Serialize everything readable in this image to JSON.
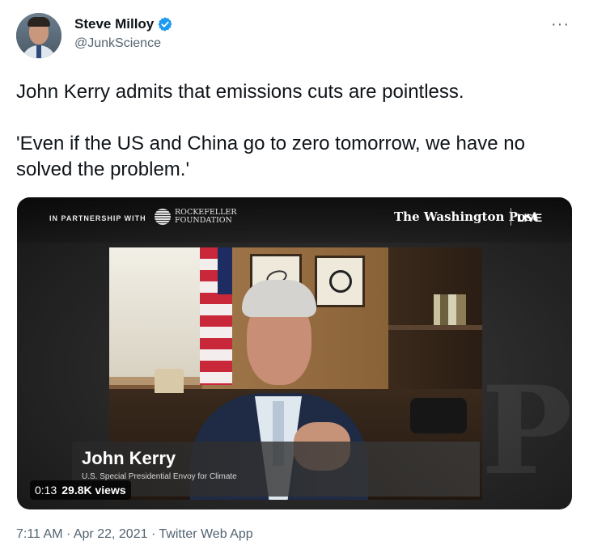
{
  "author": {
    "display_name": "Steve Milloy",
    "handle": "@JunkScience",
    "verified": true
  },
  "more_menu_glyph": "···",
  "tweet": {
    "line1": "John Kerry admits that emissions cuts are pointless.",
    "line2": "'Even if the US and China go to zero tomorrow, we have no solved the problem.'"
  },
  "video": {
    "partnership_label": "IN PARTNERSHIP WITH",
    "foundation_line1": "ROCKEFELLER",
    "foundation_line2": "FOUNDATION",
    "publisher": "The Washington Post",
    "live_label": "LIVE",
    "speaker_name": "John Kerry",
    "speaker_title": "U.S. Special Presidential Envoy for Climate",
    "timestamp": "0:13",
    "views": "29.8K views"
  },
  "meta": {
    "time": "7:11 AM",
    "separator": "·",
    "date": "Apr 22, 2021",
    "source": "Twitter Web App"
  },
  "colors": {
    "text_primary": "#0f1419",
    "text_secondary": "#536471",
    "verified_blue": "#1d9bf0"
  }
}
